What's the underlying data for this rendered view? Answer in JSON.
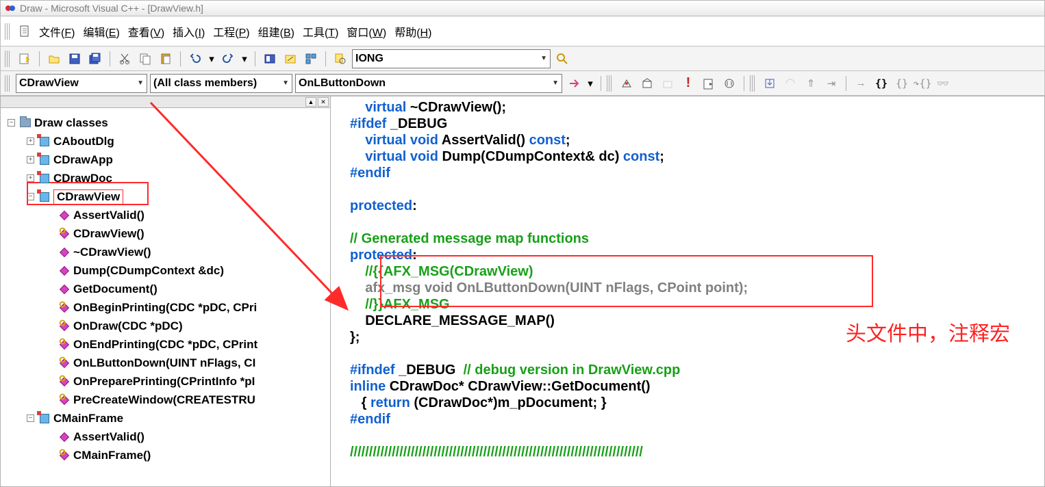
{
  "title": "Draw - Microsoft Visual C++ - [DrawView.h]",
  "menu": {
    "file": "文件",
    "file_u": "F",
    "edit": "编辑",
    "edit_u": "E",
    "view": "查看",
    "view_u": "V",
    "insert": "插入",
    "insert_u": "I",
    "project": "工程",
    "project_u": "P",
    "build": "组建",
    "build_u": "B",
    "tools": "工具",
    "tools_u": "T",
    "window": "窗口",
    "window_u": "W",
    "help": "帮助",
    "help_u": "H"
  },
  "toolbar1": {
    "combo": "IONG"
  },
  "toolbar2": {
    "class": "CDrawView",
    "members": "(All class members)",
    "function": "OnLButtonDown"
  },
  "tree": {
    "root": "Draw classes",
    "c1": "CAboutDlg",
    "c2": "CDrawApp",
    "c3": "CDrawDoc",
    "c4": "CDrawView",
    "c4f1": "AssertValid()",
    "c4f2": "CDrawView()",
    "c4f3": "~CDrawView()",
    "c4f4": "Dump(CDumpContext &dc)",
    "c4f5": "GetDocument()",
    "c4f6": "OnBeginPrinting(CDC *pDC, CPri",
    "c4f7": "OnDraw(CDC *pDC)",
    "c4f8": "OnEndPrinting(CDC *pDC, CPrint",
    "c4f9": "OnLButtonDown(UINT nFlags, CI",
    "c4f10": "OnPreparePrinting(CPrintInfo *pI",
    "c4f11": "PreCreateWindow(CREATESTRU",
    "c5": "CMainFrame",
    "c5f1": "AssertValid()",
    "c5f2": "CMainFrame()"
  },
  "code": {
    "l1a": "virtual",
    "l1b": " ~CDrawView();",
    "l2a": "#ifdef",
    "l2b": " _DEBUG",
    "l3a": "virtual",
    "l3b": " void",
    "l3c": " AssertValid() ",
    "l3d": "const",
    "l3e": ";",
    "l4a": "virtual",
    "l4b": " void",
    "l4c": " Dump(CDumpContext& dc) ",
    "l4d": "const",
    "l4e": ";",
    "l5": "#endif",
    "l6": "protected",
    "l6b": ":",
    "l7": "// Generated message map functions",
    "l8": "protected",
    "l8b": ":",
    "l9": "//{{AFX_MSG(CDrawView)",
    "l10": "afx_msg void OnLButtonDown(UINT nFlags, CPoint point);",
    "l11": "//}}AFX_MSG",
    "l12": "DECLARE_MESSAGE_MAP()",
    "l13": "};",
    "l14a": "#ifndef",
    "l14b": " _DEBUG  ",
    "l14c": "// debug version in DrawView.cpp",
    "l15a": "inline",
    "l15b": " CDrawDoc* CDrawView::GetDocument()",
    "l16a": "   { ",
    "l16b": "return",
    "l16c": " (CDrawDoc*)m_pDocument; }",
    "l17": "#endif",
    "l18": "/////////////////////////////////////////////////////////////////////////////",
    "annotation": "头文件中，注释宏"
  },
  "scroll": {
    "up": "▲",
    "x": "✕"
  }
}
